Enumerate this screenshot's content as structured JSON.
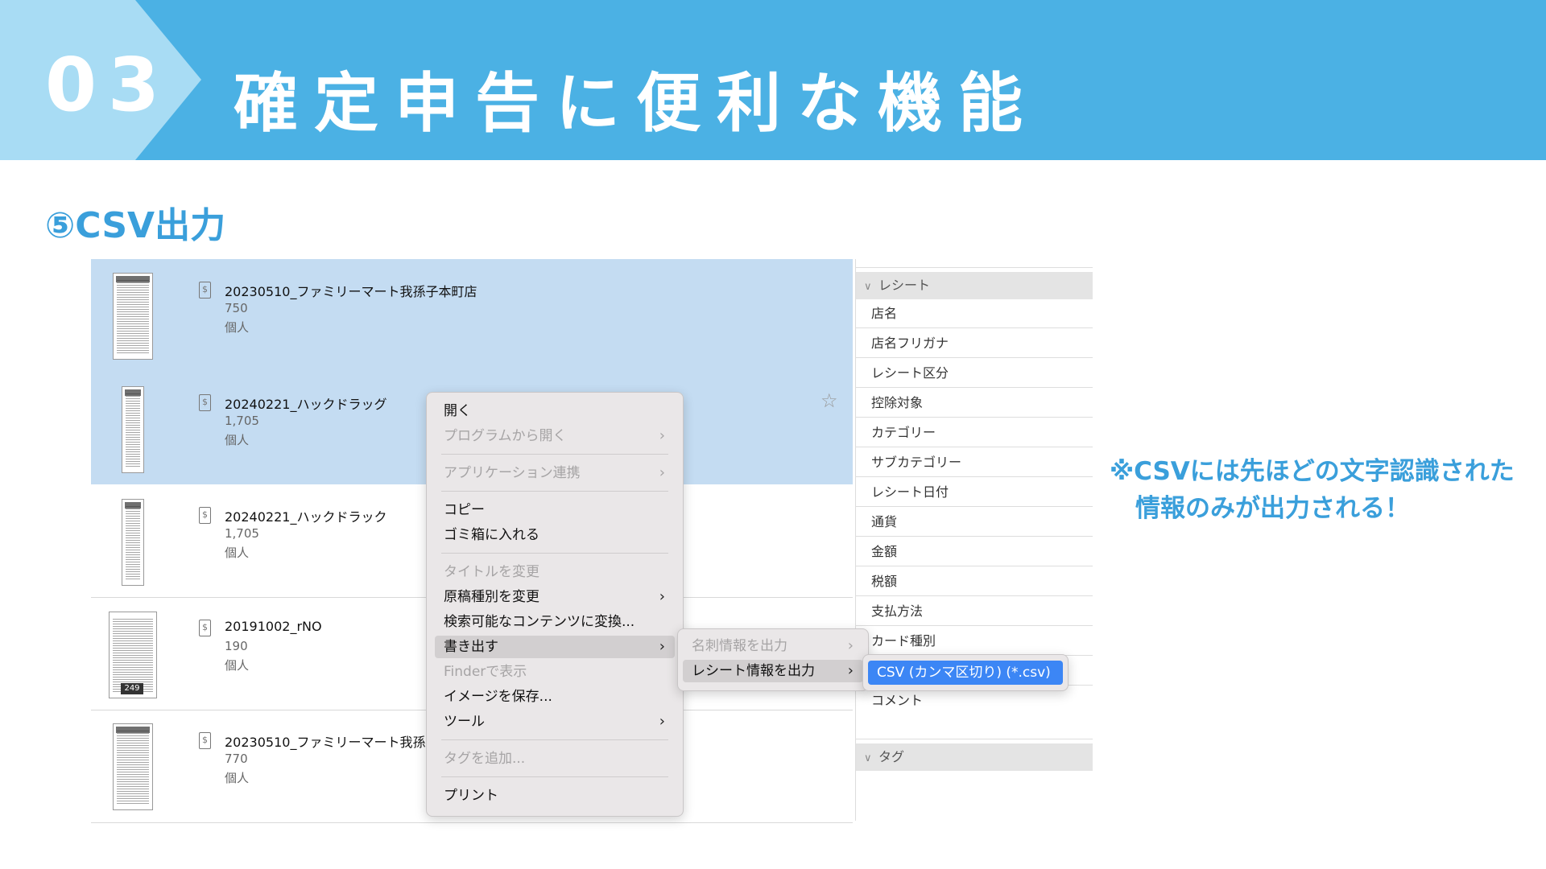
{
  "header": {
    "number": "03",
    "title": "確定申告に便利な機能"
  },
  "section": {
    "title": "⑤CSV出力"
  },
  "note": {
    "line1": "※CSVには先ほどの文字認識された",
    "line2": "情報のみが出力される！"
  },
  "documents": [
    {
      "title": "20230510_ファミリーマート我孫子本町店",
      "amount": "750",
      "owner": "個人",
      "selected": true
    },
    {
      "title": "20240221_ハックドラッグ",
      "amount": "1,705",
      "owner": "個人",
      "selected": true
    },
    {
      "title": "20240221_ハックドラック",
      "amount": "1,705",
      "owner": "個人",
      "selected": false
    },
    {
      "title": "20191002_rNO",
      "amount": "190",
      "owner": "個人",
      "selected": false,
      "thumb_badge": "249"
    },
    {
      "title": "20230510_ファミリーマート我孫子",
      "amount": "770",
      "owner": "個人",
      "selected": false
    }
  ],
  "properties": {
    "receipt_section": "レシート",
    "fields": [
      "店名",
      "店名フリガナ",
      "レシート区分",
      "控除対象",
      "カテゴリー",
      "サブカテゴリー",
      "レシート日付",
      "通貨",
      "金額",
      "税額",
      "支払方法",
      "カード種別",
      "",
      "コメント"
    ],
    "tag_section": "タグ"
  },
  "context_menu": {
    "items": [
      {
        "label": "開く",
        "enabled": true
      },
      {
        "label": "プログラムから開く",
        "enabled": false,
        "submenu": true
      },
      {
        "label": "アプリケーション連携",
        "enabled": false,
        "submenu": true
      },
      {
        "label": "コピー",
        "enabled": true
      },
      {
        "label": "ゴミ箱に入れる",
        "enabled": true
      },
      {
        "label": "タイトルを変更",
        "enabled": false
      },
      {
        "label": "原稿種別を変更",
        "enabled": true,
        "submenu": true
      },
      {
        "label": "検索可能なコンテンツに変換...",
        "enabled": true
      },
      {
        "label": "書き出す",
        "enabled": true,
        "submenu": true,
        "highlighted": true
      },
      {
        "label": "Finderで表示",
        "enabled": false
      },
      {
        "label": "イメージを保存...",
        "enabled": true
      },
      {
        "label": "ツール",
        "enabled": true,
        "submenu": true
      },
      {
        "label": "タグを追加...",
        "enabled": false
      },
      {
        "label": "プリント",
        "enabled": true
      }
    ]
  },
  "export_submenu": {
    "items": [
      {
        "label": "名刺情報を出力",
        "enabled": false,
        "submenu": true
      },
      {
        "label": "レシート情報を出力",
        "enabled": true,
        "submenu": true,
        "highlighted": true
      }
    ]
  },
  "csv_submenu": {
    "item": "CSV (カンマ区切り) (*.csv)"
  },
  "colors": {
    "banner": "#4bb1e4",
    "banner_tab": "#a8dcf4",
    "accent_text": "#3a9fdb",
    "selection": "#c4dcf2",
    "menu_highlight": "#3c86f5"
  }
}
